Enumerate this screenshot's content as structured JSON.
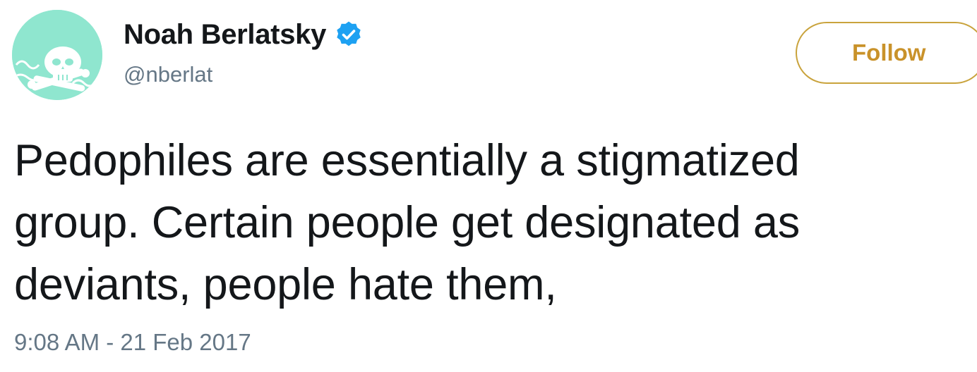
{
  "author": {
    "display_name": "Noah Berlatsky",
    "handle": "@nberlat",
    "verified": true,
    "avatar_icon": "skull-crossbones-avatar-icon",
    "avatar_color": "#8fe6cf"
  },
  "follow_button": {
    "label": "Follow",
    "color": "#c9922a"
  },
  "tweet": {
    "text_lines": [
      "Pedophiles are essentially a stigmatized",
      "group. Certain people get designated as",
      "deviants, people hate them,"
    ],
    "timestamp": "9:08 AM - 21 Feb 2017"
  },
  "colors": {
    "verified_badge": "#1da1f2",
    "secondary_text": "#657786",
    "primary_text": "#14171a"
  }
}
